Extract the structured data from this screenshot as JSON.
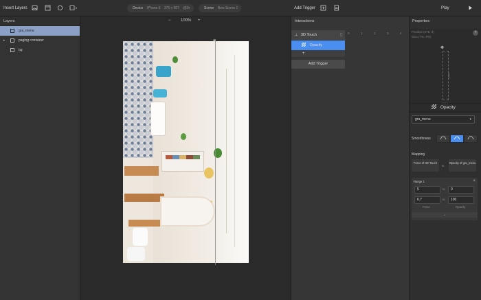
{
  "toolbar": {
    "insert_layers": "Insert Layers",
    "device_label": "Device",
    "device_value": "iPhone 6",
    "device_size": "375 x 667",
    "device_pct": "@2x",
    "scene_label": "Scene",
    "scene_value": "New Scene 1",
    "add_trigger": "Add Trigger",
    "play": "Play"
  },
  "layers": {
    "title": "Layers",
    "items": [
      {
        "label": "gra_menu",
        "selected": true
      },
      {
        "label": "paging container",
        "selected": false
      },
      {
        "label": "bg",
        "selected": false
      }
    ]
  },
  "canvas": {
    "zoom": "100%",
    "zoom_minus": "−",
    "zoom_plus": "+"
  },
  "interactions": {
    "title": "Interactions",
    "trigger": "3D Touch",
    "response": "Opacity",
    "add_response": "+",
    "add_trigger_button": "Add Trigger",
    "ruler": [
      "0",
      "1",
      "2",
      "3",
      "4"
    ]
  },
  "properties": {
    "title": "Properties",
    "position": "Position   (275, 0)",
    "size": "Size          (7%, 0%)",
    "help": "?",
    "preview_w": "100%",
    "preview_h": "100%",
    "response_title": "Opacity",
    "layer_select": "gra_menu",
    "smoothness_label": "Smoothness",
    "mapping_label": "Mapping",
    "map_from": "Force of 3D Touch",
    "map_to_arrow": "to",
    "map_to": "Opacity of gra_menu",
    "range_label": "Range 1",
    "range_close": "×",
    "from_min": "5",
    "from_max": "6.7",
    "to_min": "0",
    "to_max": "100",
    "arrow": "to",
    "col_force": "Force",
    "col_opacity": "Opacity",
    "expand": "⌄"
  },
  "colors": {
    "accent": "#4a8ef0",
    "selection": "#8aa0c4"
  }
}
